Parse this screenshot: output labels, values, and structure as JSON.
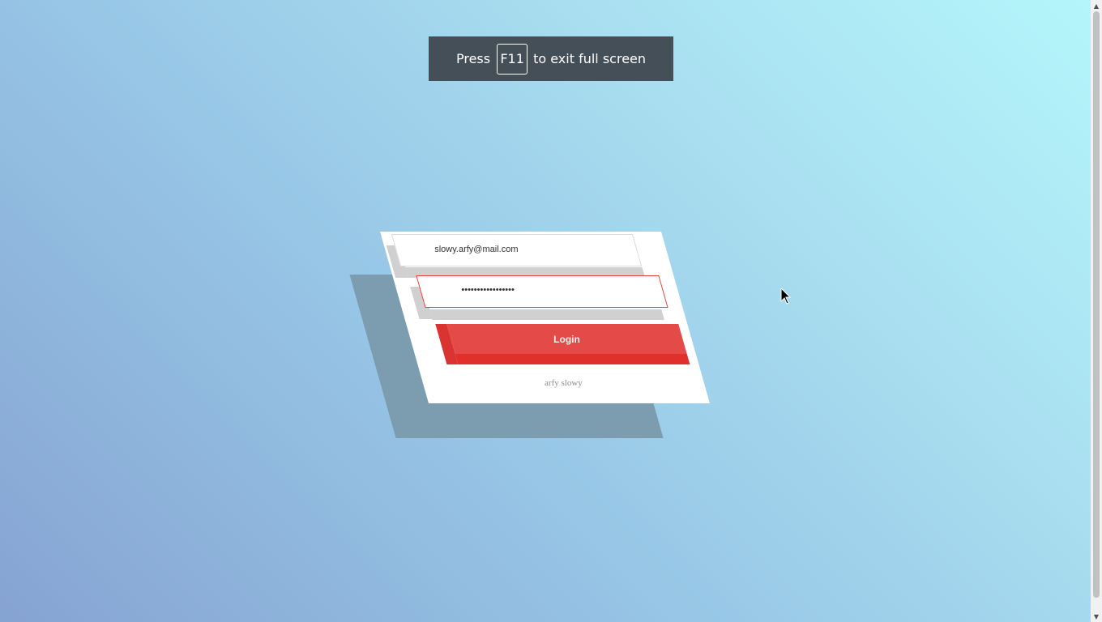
{
  "fullscreen_notice": {
    "prefix": "Press",
    "key": "F11",
    "suffix": "to exit full screen"
  },
  "login_form": {
    "email_value": "slowy.arfy@mail.com",
    "password_value": "•••••••••••••••••",
    "login_label": "Login",
    "footer": "arfy slowy",
    "accent_color": "#e44a48"
  },
  "scrollbar": {
    "up_arrow": "▲",
    "down_arrow": "▼"
  },
  "icons": {
    "cursor": "mouse-pointer-icon"
  }
}
